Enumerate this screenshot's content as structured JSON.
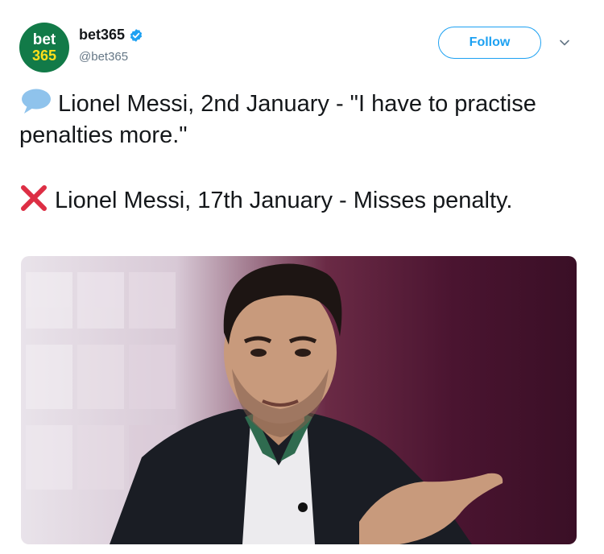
{
  "account": {
    "avatar_line1": "bet",
    "avatar_line2": "365",
    "display_name": "bet365",
    "handle": "@bet365",
    "verified": true,
    "verified_icon": "verified-badge-icon"
  },
  "actions": {
    "follow_label": "Follow",
    "more_icon": "chevron-down-icon"
  },
  "tweet": {
    "line1_icon": "speech-bubble-icon",
    "line1_text": "Lionel Messi, 2nd January - \"I have to practise penalties more.\"",
    "line2_icon": "cross-mark-icon",
    "line2_text": "Lionel Messi, 17th January - Misses penalty."
  },
  "media": {
    "type": "photo"
  },
  "colors": {
    "accent": "#1da1f2",
    "brand_green": "#127a48",
    "brand_yellow": "#ffdf1b",
    "muted_text": "#657786"
  }
}
